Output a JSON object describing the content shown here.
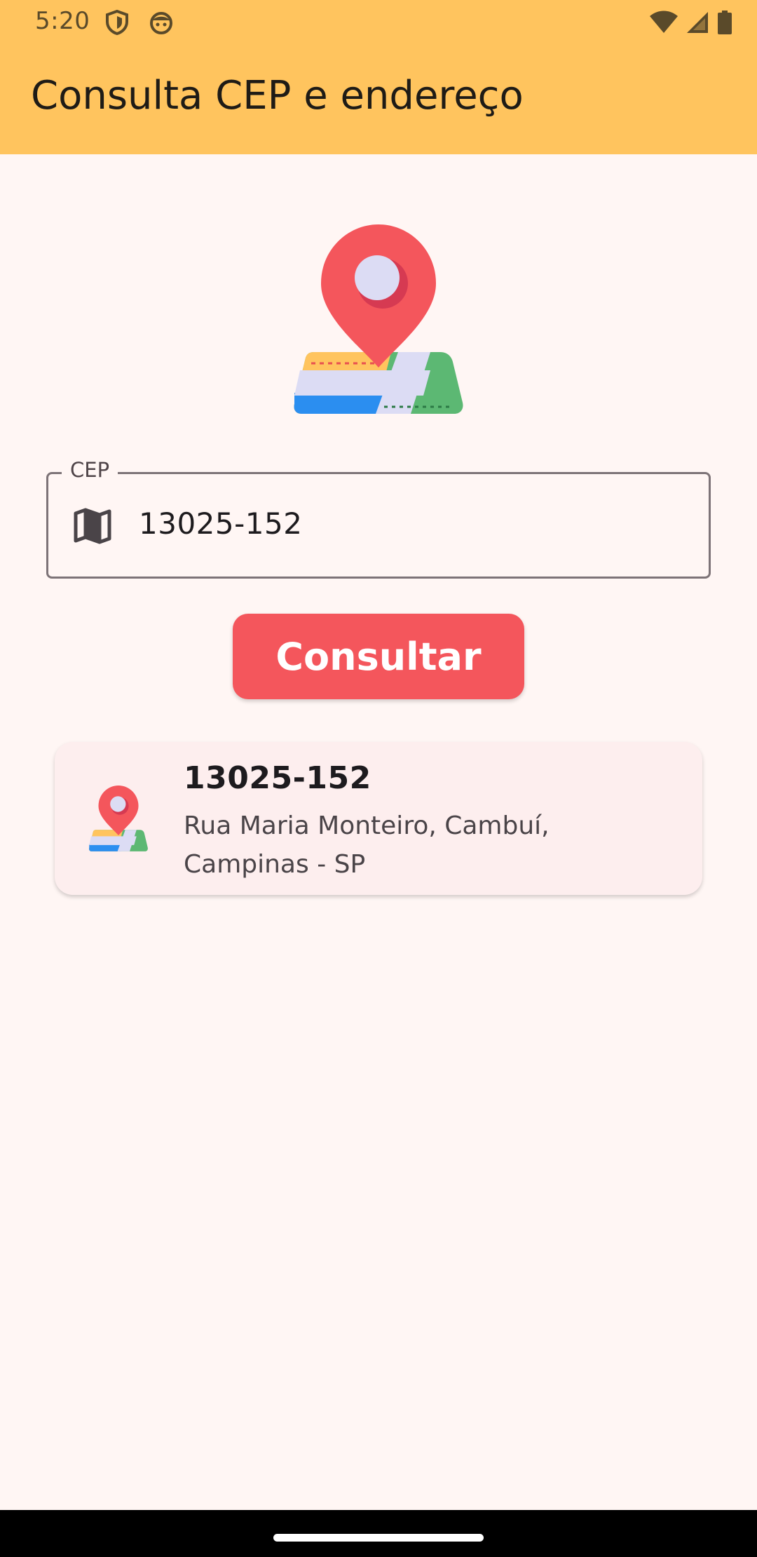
{
  "status_bar": {
    "time": "5:20",
    "left_icons": [
      "shield-icon",
      "android-face-icon"
    ],
    "right_icons": [
      "wifi-icon",
      "cell-signal-icon",
      "battery-icon"
    ]
  },
  "app_bar": {
    "title": "Consulta CEP e endereço",
    "background": "#ffc45e"
  },
  "hero": {
    "icon": "map-pin-illustration-icon"
  },
  "cep_input": {
    "label": "CEP",
    "value": "13025-152",
    "icon": "map-icon"
  },
  "consult_button": {
    "label": "Consultar",
    "color": "#f4565c"
  },
  "result": {
    "cep": "13025-152",
    "address": "Rua Maria Monteiro, Cambuí, Campinas - SP",
    "icon": "map-pin-illustration-icon"
  },
  "colors": {
    "background": "#fff6f4",
    "accent": "#f4565c",
    "card": "#fdeeee"
  }
}
